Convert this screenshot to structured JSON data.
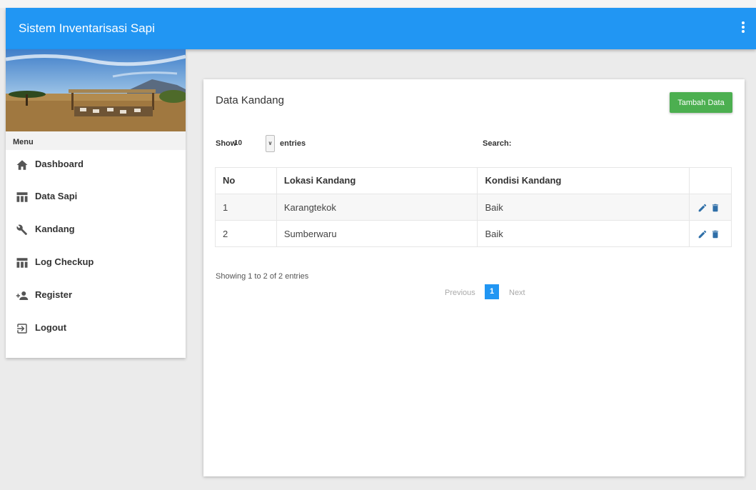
{
  "appbar": {
    "title": "Sistem Inventarisasi Sapi",
    "icon": "more-vertical-icon"
  },
  "sidebar": {
    "menu_header": "Menu",
    "items": [
      {
        "label": "Dashboard",
        "icon": "home-icon"
      },
      {
        "label": "Data Sapi",
        "icon": "table-icon"
      },
      {
        "label": "Kandang",
        "icon": "wrench-icon"
      },
      {
        "label": "Log Checkup",
        "icon": "table-icon"
      },
      {
        "label": "Register",
        "icon": "person-add-icon"
      },
      {
        "label": "Logout",
        "icon": "exit-icon"
      }
    ]
  },
  "card": {
    "title": "Data Kandang",
    "add_button": "Tambah Data",
    "length": {
      "show": "Show",
      "value": "10",
      "entries": "entries"
    },
    "search": {
      "label": "Search:",
      "value": ""
    },
    "table": {
      "columns": [
        "No",
        "Lokasi Kandang",
        "Kondisi Kandang",
        ""
      ],
      "rows": [
        {
          "no": "1",
          "lokasi": "Karangtekok",
          "kondisi": "Baik"
        },
        {
          "no": "2",
          "lokasi": "Sumberwaru",
          "kondisi": "Baik"
        }
      ]
    },
    "info": "Showing 1 to 2 of 2 entries",
    "pagination": {
      "previous": "Previous",
      "current": "1",
      "next": "Next"
    }
  },
  "colors": {
    "primary": "#2196f3",
    "success": "#4caf50",
    "action_icon": "#2f6fa8"
  }
}
